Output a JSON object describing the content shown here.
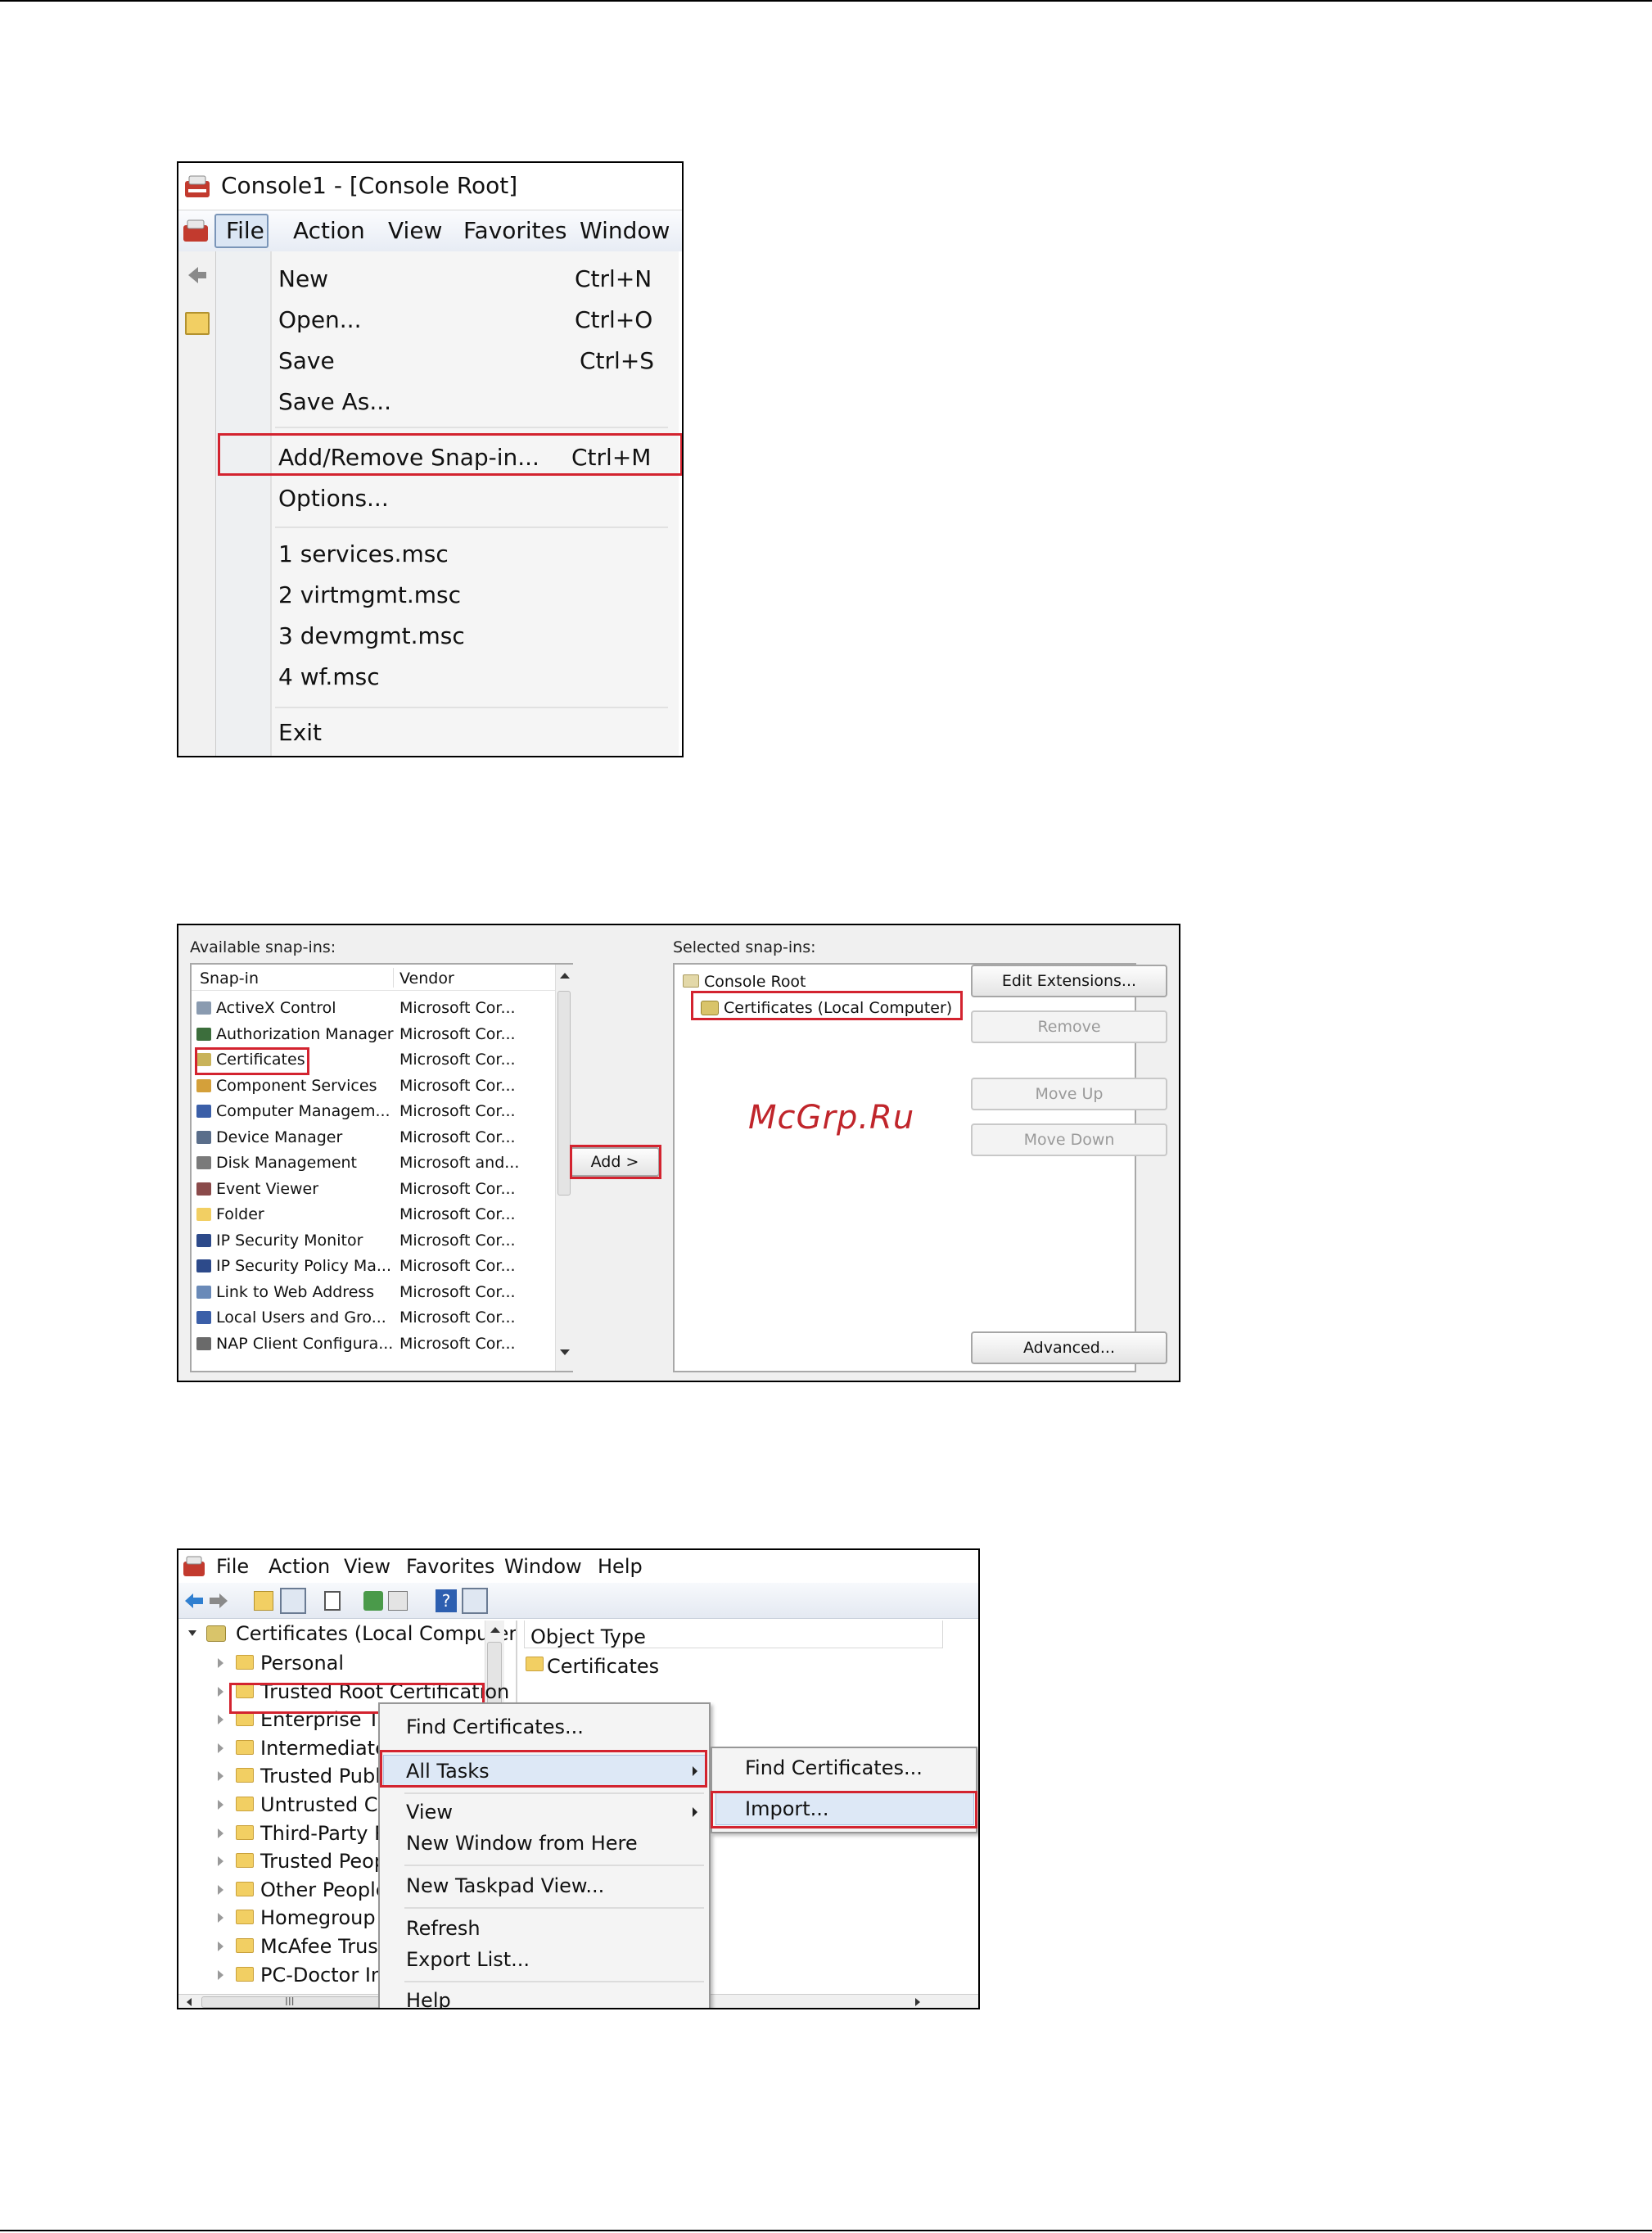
{
  "watermark": "McGrp.Ru",
  "shot1": {
    "title": "Console1 - [Console Root]",
    "menubar": [
      "File",
      "Action",
      "View",
      "Favorites",
      "Window"
    ],
    "menu_items": [
      {
        "label": "New",
        "shortcut": "Ctrl+N"
      },
      {
        "label": "Open...",
        "shortcut": "Ctrl+O"
      },
      {
        "label": "Save",
        "shortcut": "Ctrl+S"
      },
      {
        "label": "Save As...",
        "shortcut": ""
      },
      {
        "label": "Add/Remove Snap-in...",
        "shortcut": "Ctrl+M"
      },
      {
        "label": "Options...",
        "shortcut": ""
      },
      {
        "label": "1 services.msc",
        "shortcut": ""
      },
      {
        "label": "2 virtmgmt.msc",
        "shortcut": ""
      },
      {
        "label": "3 devmgmt.msc",
        "shortcut": ""
      },
      {
        "label": "4 wf.msc",
        "shortcut": ""
      },
      {
        "label": "Exit",
        "shortcut": ""
      }
    ]
  },
  "shot2": {
    "available_label": "Available snap-ins:",
    "selected_label": "Selected snap-ins:",
    "columns": [
      "Snap-in",
      "Vendor"
    ],
    "rows": [
      {
        "name": "ActiveX Control",
        "vendor": "Microsoft Cor...",
        "color": "#8a9bb0"
      },
      {
        "name": "Authorization Manager",
        "vendor": "Microsoft Cor...",
        "color": "#3c6e3c"
      },
      {
        "name": "Certificates",
        "vendor": "Microsoft Cor...",
        "color": "#c9b35a"
      },
      {
        "name": "Component Services",
        "vendor": "Microsoft Cor...",
        "color": "#d4a03a"
      },
      {
        "name": "Computer Managem...",
        "vendor": "Microsoft Cor...",
        "color": "#3b5fa8"
      },
      {
        "name": "Device Manager",
        "vendor": "Microsoft Cor...",
        "color": "#5a6e8a"
      },
      {
        "name": "Disk Management",
        "vendor": "Microsoft and...",
        "color": "#7a7a7a"
      },
      {
        "name": "Event Viewer",
        "vendor": "Microsoft Cor...",
        "color": "#8a4a4a"
      },
      {
        "name": "Folder",
        "vendor": "Microsoft Cor...",
        "color": "#f2cf63"
      },
      {
        "name": "IP Security Monitor",
        "vendor": "Microsoft Cor...",
        "color": "#2d4a8a"
      },
      {
        "name": "IP Security Policy Ma...",
        "vendor": "Microsoft Cor...",
        "color": "#2d4a8a"
      },
      {
        "name": "Link to Web Address",
        "vendor": "Microsoft Cor...",
        "color": "#6a8ab8"
      },
      {
        "name": "Local Users and Gro...",
        "vendor": "Microsoft Cor...",
        "color": "#3b5fa8"
      },
      {
        "name": "NAP Client Configura...",
        "vendor": "Microsoft Cor...",
        "color": "#6a6a6a"
      }
    ],
    "add_button": "Add >",
    "selected_root": "Console Root",
    "selected_child": "Certificates (Local Computer)",
    "buttons": {
      "edit_extensions": "Edit Extensions...",
      "remove": "Remove",
      "move_up": "Move Up",
      "move_down": "Move Down",
      "advanced": "Advanced..."
    }
  },
  "shot3": {
    "menubar": [
      "File",
      "Action",
      "View",
      "Favorites",
      "Window",
      "Help"
    ],
    "tree_root": "Certificates (Local Computer",
    "tree_items": [
      "Personal",
      "Trusted Root Certification",
      "Enterprise Tru",
      "Intermediate",
      "Trusted Publis",
      "Untrusted Cer",
      "Third-Party Ro",
      "Trusted Peopl",
      "Other People",
      "Homegroup M",
      "McAfee Trust",
      "PC-Doctor In"
    ],
    "right_header": "Object Type",
    "right_item": "Certificates",
    "context_menu": {
      "find": "Find Certificates...",
      "all_tasks": "All Tasks",
      "view": "View",
      "new_window": "New Window from Here",
      "new_taskpad": "New Taskpad View...",
      "refresh": "Refresh",
      "export": "Export List...",
      "help": "Help"
    },
    "submenu": {
      "find": "Find Certificates...",
      "import": "Import..."
    },
    "scroll_mark": "III"
  }
}
